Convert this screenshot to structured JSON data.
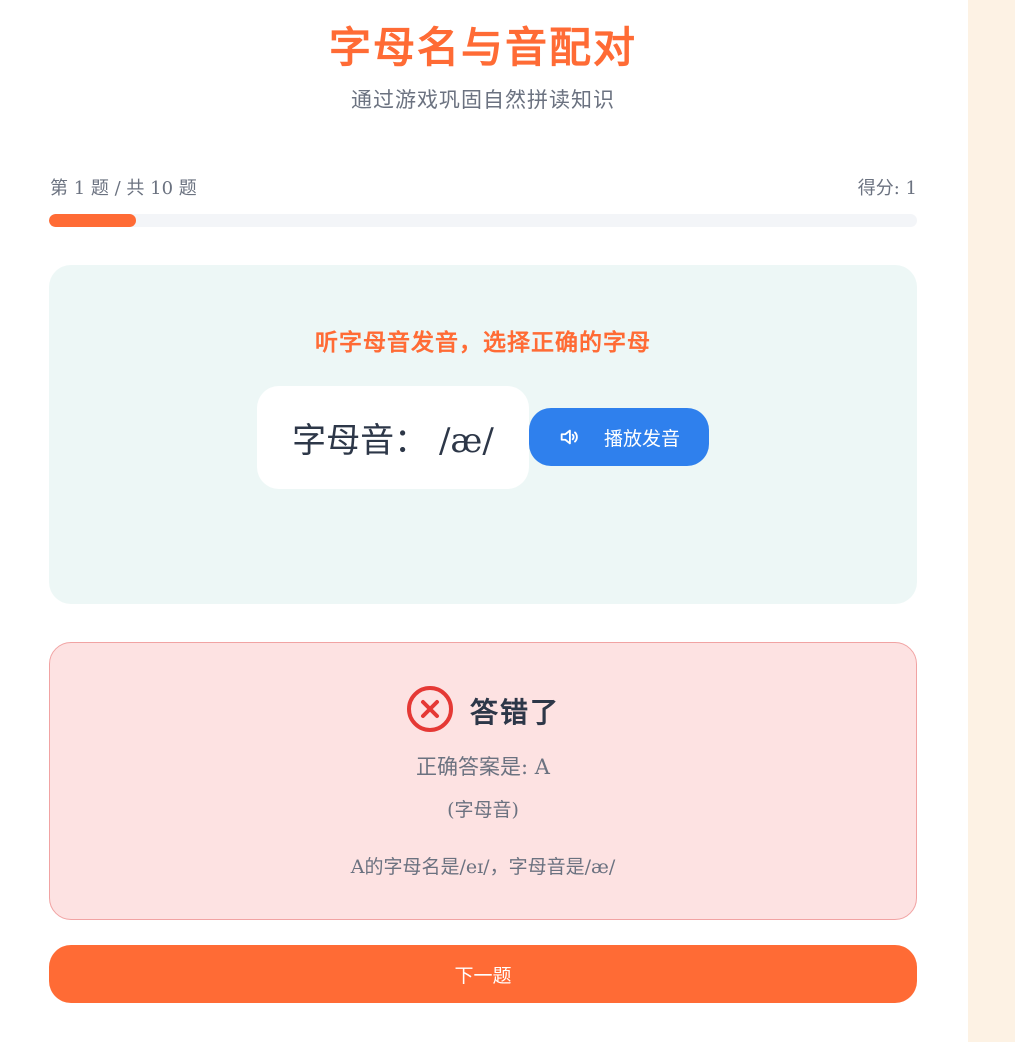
{
  "header": {
    "title": "字母名与音配对",
    "subtitle": "通过游戏巩固自然拼读知识"
  },
  "progress": {
    "label": "第 1 题 / 共 10 题",
    "score_label": "得分: 1",
    "fraction": 0.1
  },
  "question": {
    "prompt": "听字母音发音，选择正确的字母",
    "sound_label": "字母音： /æ/",
    "play_button_label": "播放发音",
    "play_icon": "speaker-icon"
  },
  "result": {
    "icon": "error-circle-icon",
    "title": "答错了",
    "correct_answer": "正确答案是: A",
    "answer_type": "(字母音)",
    "explanation": "A的字母名是/eɪ/，字母音是/æ/"
  },
  "next_button_label": "下一题",
  "colors": {
    "accent": "#ff6b35",
    "play_button": "#2f80ed",
    "question_bg": "#edf7f6",
    "error_bg": "#fde2e2",
    "error_icon": "#e53935"
  }
}
